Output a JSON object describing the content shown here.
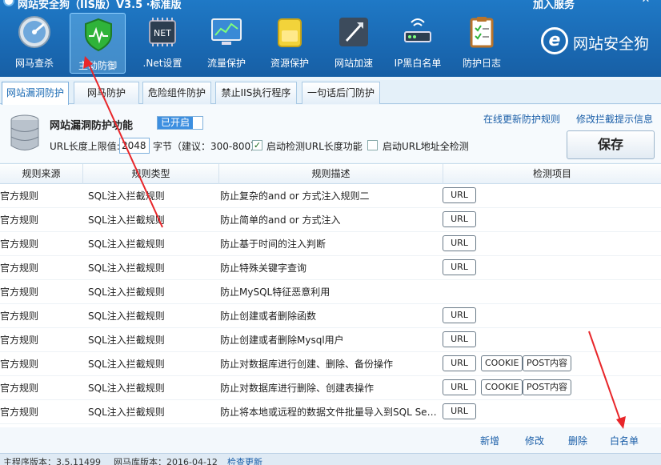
{
  "window": {
    "title": "网站安全狗（IIS版）V3.5 ·标准版",
    "join_service": "加入服务",
    "minimize": "—",
    "close": "✕"
  },
  "toolbar": [
    {
      "label": "网马查杀",
      "icon": "globe-scan-icon"
    },
    {
      "label": "主动防御",
      "icon": "shield-icon"
    },
    {
      "label": ".Net设置",
      "icon": "net-chip-icon"
    },
    {
      "label": "流量保护",
      "icon": "monitor-chart-icon"
    },
    {
      "label": "资源保护",
      "icon": "folder-icon"
    },
    {
      "label": "网站加速",
      "icon": "rocket-icon"
    },
    {
      "label": "IP黑白名单",
      "icon": "router-icon"
    },
    {
      "label": "防护日志",
      "icon": "clipboard-icon"
    }
  ],
  "brand": {
    "logo_letter": "e",
    "logo_text": "网站安全狗"
  },
  "tabs": [
    {
      "label": "网站漏洞防护"
    },
    {
      "label": "网马防护"
    },
    {
      "label": "危险组件防护"
    },
    {
      "label": "禁止IIS执行程序"
    },
    {
      "label": "一句话后门防护"
    }
  ],
  "panel": {
    "title": "网站漏洞防护功能",
    "status": "已开启",
    "update_link": "在线更新防护规则",
    "modify_link": "修改拦截提示信息",
    "url_len_label": "URL长度上限值:",
    "url_len_value": "2048",
    "url_len_suffix": "字节（建议：300-800）",
    "check1_label": "启动检测URL长度功能",
    "check1_checked": true,
    "check2_label": "启动URL地址全检测",
    "check2_checked": false,
    "save_label": "保存"
  },
  "table": {
    "headers": [
      "规则来源",
      "规则类型",
      "规则描述",
      "检测项目"
    ],
    "rows": [
      {
        "source": "官方规则",
        "type": "SQL注入拦截规则",
        "desc": "防止复杂的and or 方式注入规则二",
        "checks": [
          "URL"
        ]
      },
      {
        "source": "官方规则",
        "type": "SQL注入拦截规则",
        "desc": "防止简单的and or 方式注入",
        "checks": [
          "URL"
        ]
      },
      {
        "source": "官方规则",
        "type": "SQL注入拦截规则",
        "desc": "防止基于时间的注入判断",
        "checks": [
          "URL"
        ]
      },
      {
        "source": "官方规则",
        "type": "SQL注入拦截规则",
        "desc": "防止特殊关键字查询",
        "checks": [
          "URL"
        ]
      },
      {
        "source": "官方规则",
        "type": "SQL注入拦截规则",
        "desc": "防止MySQL特征恶意利用",
        "checks": []
      },
      {
        "source": "官方规则",
        "type": "SQL注入拦截规则",
        "desc": "防止创建或者删除函数",
        "checks": [
          "URL"
        ]
      },
      {
        "source": "官方规则",
        "type": "SQL注入拦截规则",
        "desc": "防止创建或者删除Mysql用户",
        "checks": [
          "URL"
        ]
      },
      {
        "source": "官方规则",
        "type": "SQL注入拦截规则",
        "desc": "防止对数据库进行创建、删除、备份操作",
        "checks": [
          "URL",
          "COOKIE",
          "POST内容"
        ]
      },
      {
        "source": "官方规则",
        "type": "SQL注入拦截规则",
        "desc": "防止对数据库进行删除、创建表操作",
        "checks": [
          "URL",
          "COOKIE",
          "POST内容"
        ]
      },
      {
        "source": "官方规则",
        "type": "SQL注入拦截规则",
        "desc": "防止将本地或远程的数据文件批量导入到SQL Server",
        "checks": [
          "URL"
        ]
      },
      {
        "source": "官方规则",
        "type": "SQL注入拦截规则",
        "desc": "",
        "checks": []
      }
    ]
  },
  "actions": {
    "add": "新增",
    "edit": "修改",
    "delete": "删除",
    "whitelist": "白名单"
  },
  "status_bar": {
    "main_version": "主程序版本：3.5.11499",
    "virus_db": "网马库版本：2016-04-12",
    "check_update": "检查更新"
  },
  "colors": {
    "header": "#1a6ab4",
    "accent": "#3d8fe0",
    "arrow": "#e8262a",
    "link": "#1a5ea8"
  }
}
